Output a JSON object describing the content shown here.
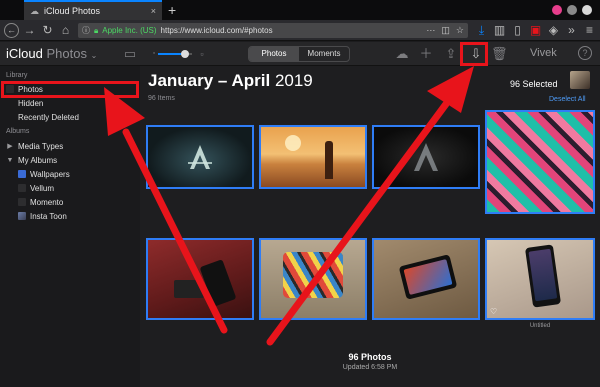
{
  "browser": {
    "tab_title": "iCloud Photos",
    "tab_close": "×",
    "new_tab": "+",
    "site_identity": "Apple Inc. (US)",
    "url": "https://www.icloud.com/#photos",
    "icons": [
      "back-icon",
      "forward-icon",
      "reload-icon",
      "home-icon",
      "lock-icon",
      "more-icon",
      "bookmark-star-icon",
      "download-icon",
      "library-icon",
      "sidebar-icon",
      "extension-icon",
      "overflow-icon",
      "menu-icon"
    ],
    "window_controls_colors": [
      "#e83e8c",
      "#8a8a8a",
      "#d9d9d9"
    ]
  },
  "toolbar": {
    "brand": "iCloud",
    "app_name": "Photos",
    "segments": [
      "Photos",
      "Moments"
    ],
    "active_segment": "Photos",
    "user_name": "Vivek",
    "help": "?"
  },
  "sidebar": {
    "library_heading": "Library",
    "library_items": [
      {
        "label": "Photos",
        "selected": true
      },
      {
        "label": "Hidden"
      },
      {
        "label": "Recently Deleted"
      }
    ],
    "albums_heading": "Albums",
    "album_items": [
      {
        "label": "Media Types"
      },
      {
        "label": "My Albums"
      },
      {
        "label": "Wallpapers"
      },
      {
        "label": "Vellum"
      },
      {
        "label": "Momento"
      },
      {
        "label": "Insta Toon"
      }
    ]
  },
  "content": {
    "title": "January – April",
    "year": "2019",
    "item_count": "96 Items",
    "selected_text": "96 Selected",
    "deselect_all": "Deselect All",
    "photos": [
      {
        "name": "photo-creed-logo-dark"
      },
      {
        "name": "photo-desert-sunset"
      },
      {
        "name": "photo-creed-logo-black"
      },
      {
        "name": "photo-tropical-leaves"
      },
      {
        "name": "photo-phone-on-bed"
      },
      {
        "name": "photo-phone-cartoon-case"
      },
      {
        "name": "photo-phone-on-desk"
      },
      {
        "name": "photo-phone-in-hand"
      }
    ],
    "untitled_caption": "Untitled",
    "footer_count": "96 Photos",
    "footer_updated": "Updated 6:58 PM"
  },
  "colors": {
    "selection_blue": "#2f7df6",
    "annotation_red": "#e8141b",
    "link_blue": "#4f9df9"
  }
}
